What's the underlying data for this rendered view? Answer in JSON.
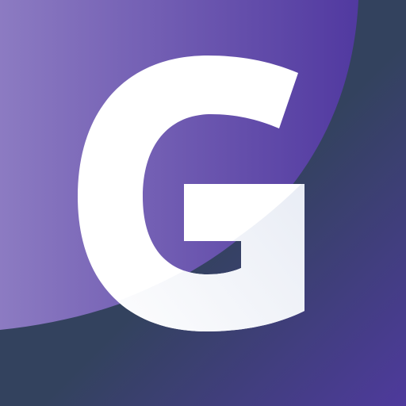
{
  "logo": {
    "letter": "G",
    "colors": {
      "background_dark": "#33425E",
      "corner_purple": "#4E3A9C",
      "arc_light": "#8C7BC2",
      "arc_deep": "#5139A0",
      "letter_white": "#FFFFFF",
      "letter_shadow": "#E2E7F2"
    }
  }
}
